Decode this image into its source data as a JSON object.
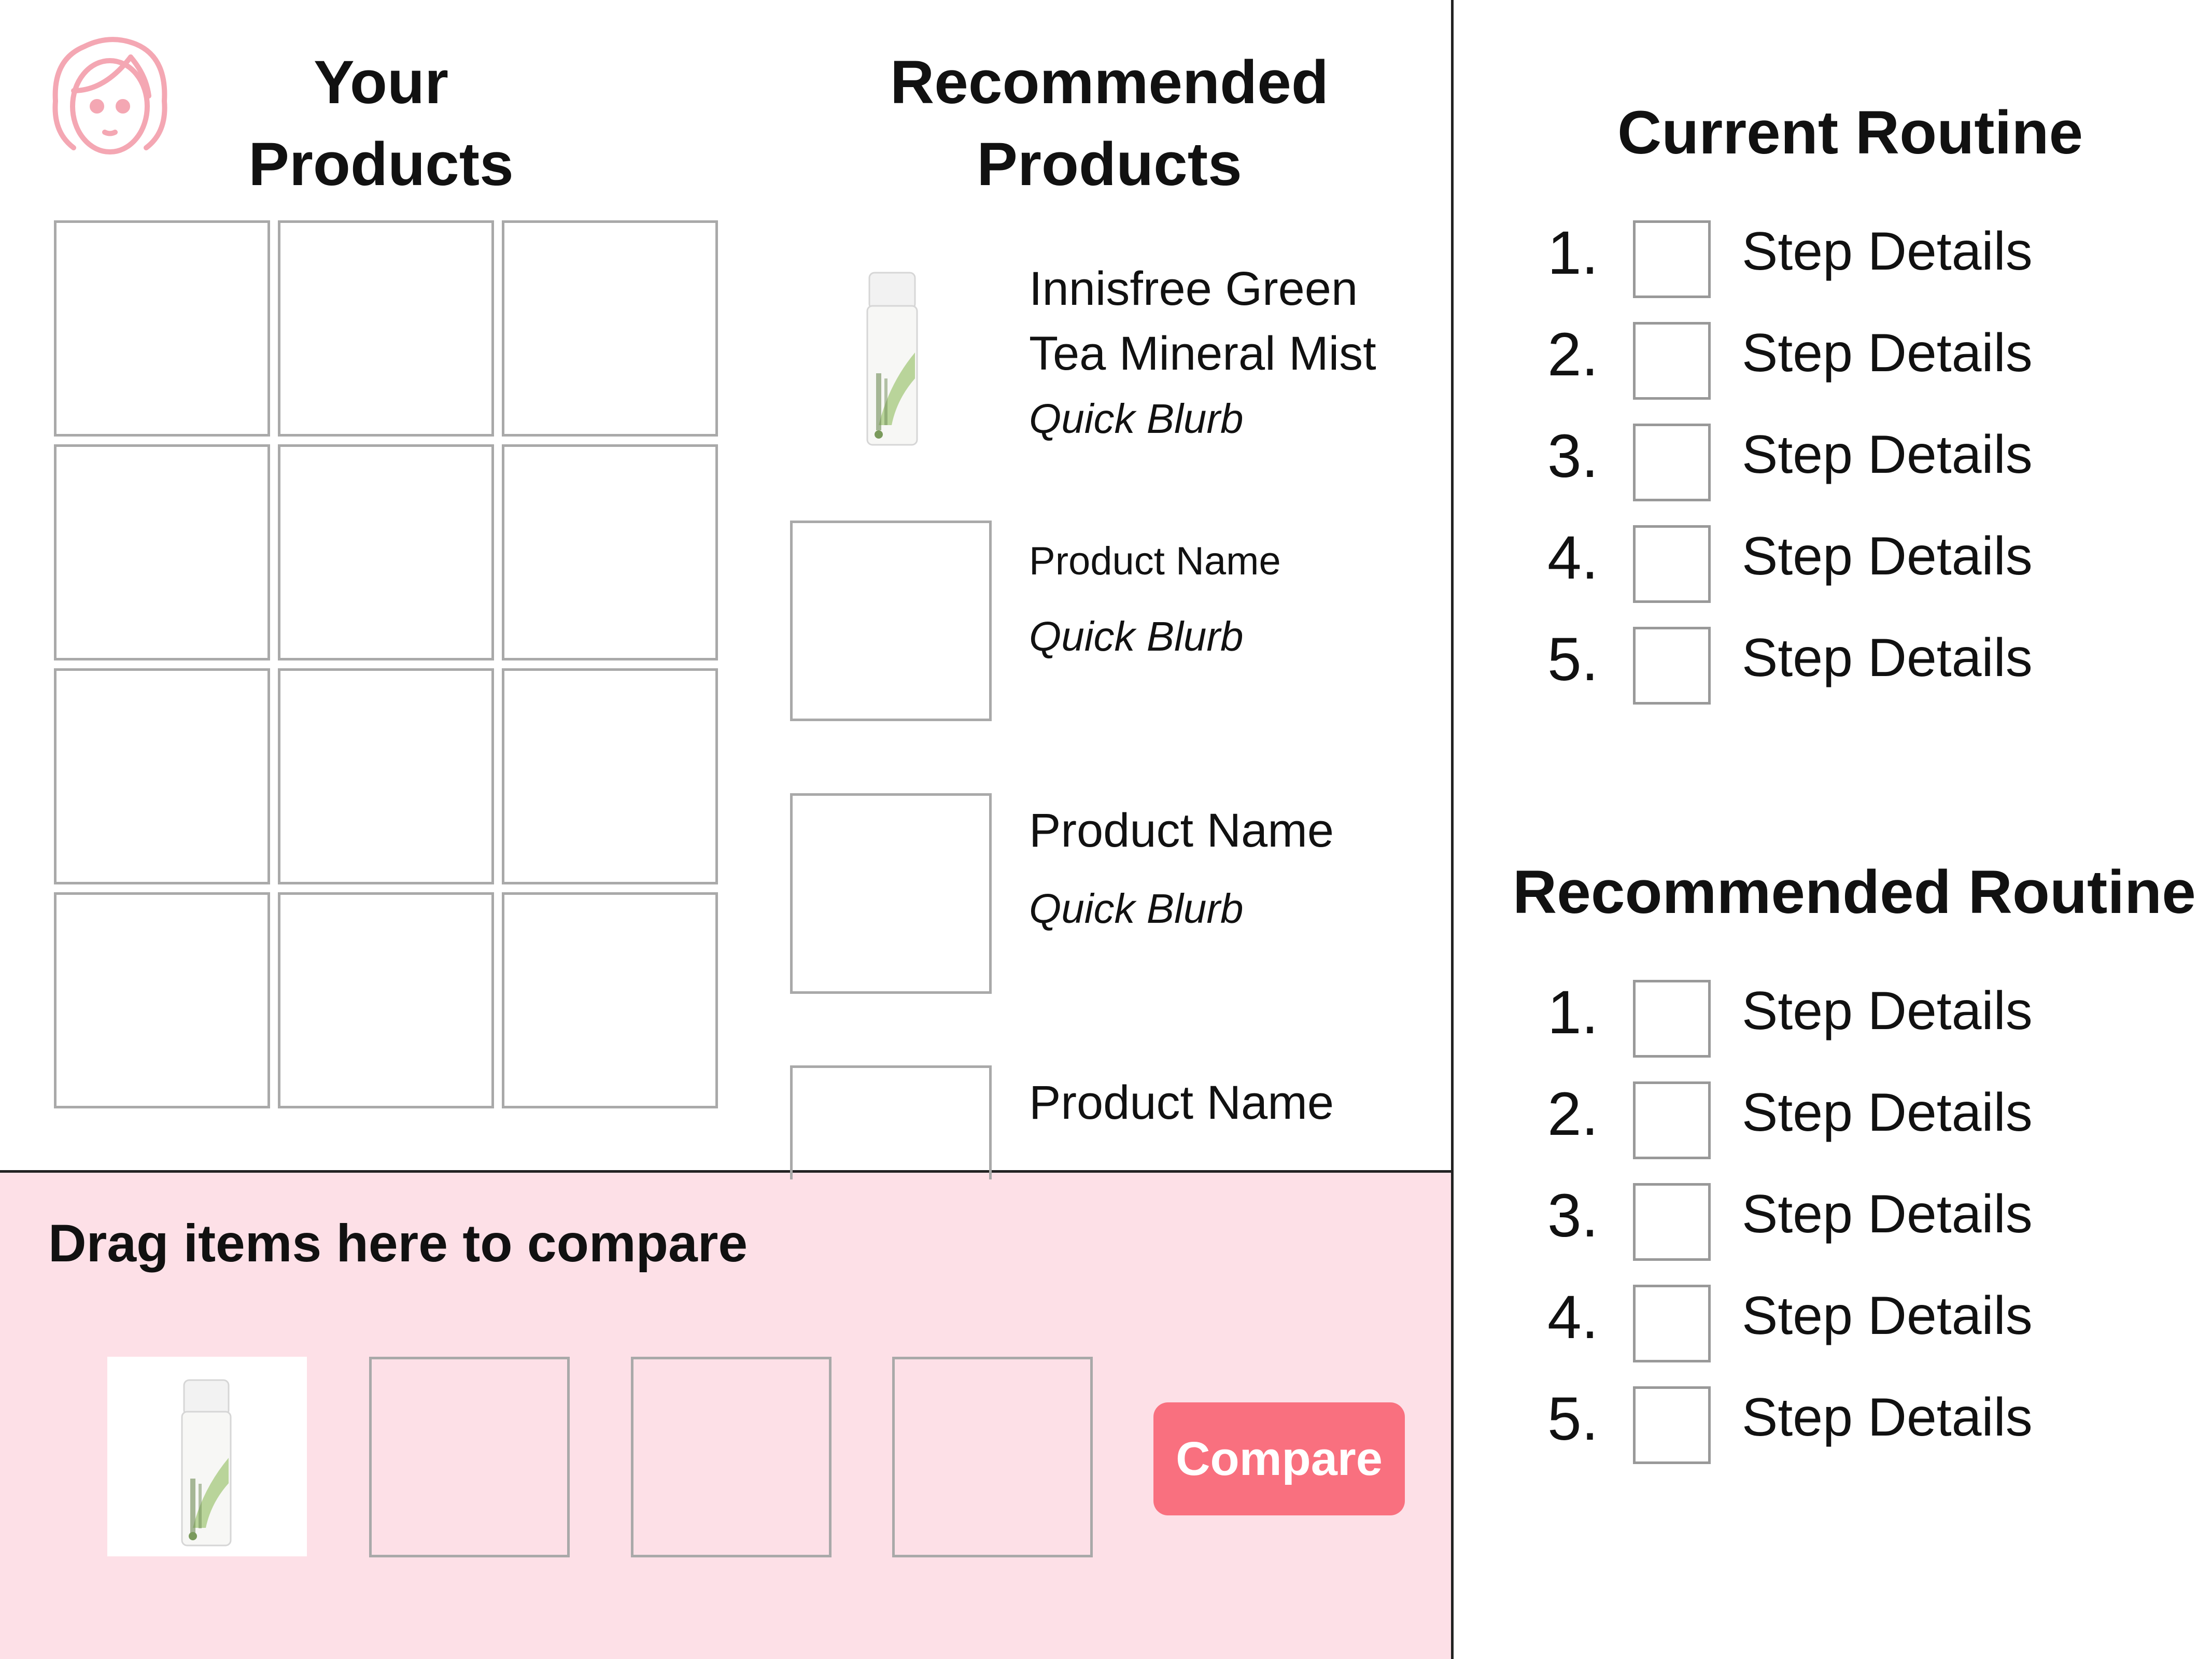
{
  "colors": {
    "accent": "#f9707f",
    "compare_background": "#fde0e7",
    "avatar_stroke": "#f4a7b3",
    "slot_border": "#a9a9a9"
  },
  "header": {
    "avatar_icon": "user-avatar-icon"
  },
  "your_products": {
    "title_line1": "Your",
    "title_line2": "Products",
    "slots": 12
  },
  "recommended_products": {
    "title_line1": "Recommended",
    "title_line2": "Products",
    "items": [
      {
        "name_line1": "Innisfree Green",
        "name_line2": "Tea Mineral Mist",
        "blurb": "Quick Blurb",
        "image": "mist-bottle-icon"
      },
      {
        "name": "Product Name",
        "blurb": "Quick Blurb"
      },
      {
        "name": "Product Name",
        "blurb": "Quick Blurb"
      },
      {
        "name": "Product Name"
      }
    ]
  },
  "current_routine": {
    "title": "Current Routine",
    "steps": [
      {
        "number": "1.",
        "label": "Step Details"
      },
      {
        "number": "2.",
        "label": "Step Details"
      },
      {
        "number": "3.",
        "label": "Step Details"
      },
      {
        "number": "4.",
        "label": "Step Details"
      },
      {
        "number": "5.",
        "label": "Step Details"
      }
    ]
  },
  "recommended_routine": {
    "title": "Recommended Routine",
    "steps": [
      {
        "number": "1.",
        "label": "Step Details"
      },
      {
        "number": "2.",
        "label": "Step Details"
      },
      {
        "number": "3.",
        "label": "Step Details"
      },
      {
        "number": "4.",
        "label": "Step Details"
      },
      {
        "number": "5.",
        "label": "Step Details"
      }
    ]
  },
  "compare": {
    "title": "Drag items here to compare",
    "button_label": "Compare",
    "first_item_image": "mist-bottle-icon"
  }
}
